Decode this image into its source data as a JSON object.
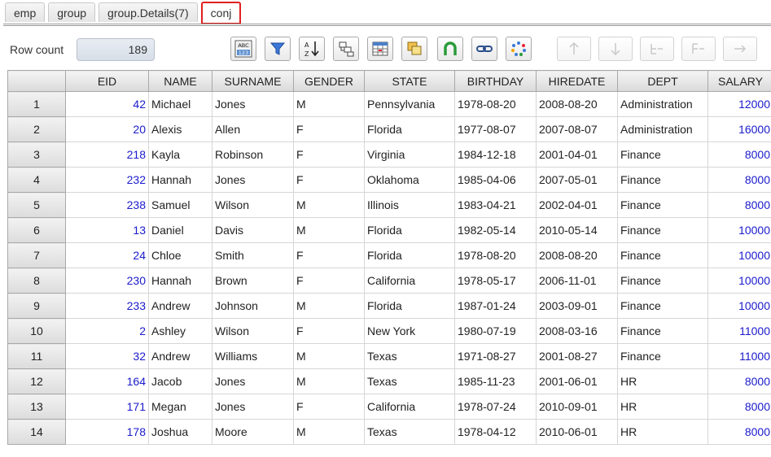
{
  "tabs": [
    {
      "label": "emp",
      "active": false
    },
    {
      "label": "group",
      "active": false
    },
    {
      "label": "group.Details(7)",
      "active": false
    },
    {
      "label": "conj",
      "active": true
    }
  ],
  "toolbar": {
    "row_count_label": "Row count",
    "row_count_value": "189",
    "buttons": [
      "abc-123-format-icon",
      "filter-icon",
      "sort-az-icon",
      "group-icon",
      "table-view-icon",
      "copy-icon",
      "horseshoe-icon",
      "link-icon",
      "spinner-icon",
      "arrow-up-icon",
      "arrow-down-icon",
      "tree-expand-icon",
      "tree-collapse-icon",
      "go-to-icon"
    ]
  },
  "colors": {
    "numeric": "#1a1acc",
    "highlight": "#e02020"
  },
  "table": {
    "columns": [
      "EID",
      "NAME",
      "SURNAME",
      "GENDER",
      "STATE",
      "BIRTHDAY",
      "HIREDATE",
      "DEPT",
      "SALARY"
    ],
    "rows": [
      [
        "1",
        "42",
        "Michael",
        "Jones",
        "M",
        "Pennsylvania",
        "1978-08-20",
        "2008-08-20",
        "Administration",
        "12000"
      ],
      [
        "2",
        "20",
        "Alexis",
        "Allen",
        "F",
        "Florida",
        "1977-08-07",
        "2007-08-07",
        "Administration",
        "16000"
      ],
      [
        "3",
        "218",
        "Kayla",
        "Robinson",
        "F",
        "Virginia",
        "1984-12-18",
        "2001-04-01",
        "Finance",
        "8000"
      ],
      [
        "4",
        "232",
        "Hannah",
        "Jones",
        "F",
        "Oklahoma",
        "1985-04-06",
        "2007-05-01",
        "Finance",
        "8000"
      ],
      [
        "5",
        "238",
        "Samuel",
        "Wilson",
        "M",
        "Illinois",
        "1983-04-21",
        "2002-04-01",
        "Finance",
        "8000"
      ],
      [
        "6",
        "13",
        "Daniel",
        "Davis",
        "M",
        "Florida",
        "1982-05-14",
        "2010-05-14",
        "Finance",
        "10000"
      ],
      [
        "7",
        "24",
        "Chloe",
        "Smith",
        "F",
        "Florida",
        "1978-08-20",
        "2008-08-20",
        "Finance",
        "10000"
      ],
      [
        "8",
        "230",
        "Hannah",
        "Brown",
        "F",
        "California",
        "1978-05-17",
        "2006-11-01",
        "Finance",
        "10000"
      ],
      [
        "9",
        "233",
        "Andrew",
        "Johnson",
        "M",
        "Florida",
        "1987-01-24",
        "2003-09-01",
        "Finance",
        "10000"
      ],
      [
        "10",
        "2",
        "Ashley",
        "Wilson",
        "F",
        "New York",
        "1980-07-19",
        "2008-03-16",
        "Finance",
        "11000"
      ],
      [
        "11",
        "32",
        "Andrew",
        "Williams",
        "M",
        "Texas",
        "1971-08-27",
        "2001-08-27",
        "Finance",
        "11000"
      ],
      [
        "12",
        "164",
        "Jacob",
        "Jones",
        "M",
        "Texas",
        "1985-11-23",
        "2001-06-01",
        "HR",
        "8000"
      ],
      [
        "13",
        "171",
        "Megan",
        "Jones",
        "F",
        "California",
        "1978-07-24",
        "2010-09-01",
        "HR",
        "8000"
      ],
      [
        "14",
        "178",
        "Joshua",
        "Moore",
        "M",
        "Texas",
        "1978-04-12",
        "2010-06-01",
        "HR",
        "8000"
      ]
    ]
  }
}
